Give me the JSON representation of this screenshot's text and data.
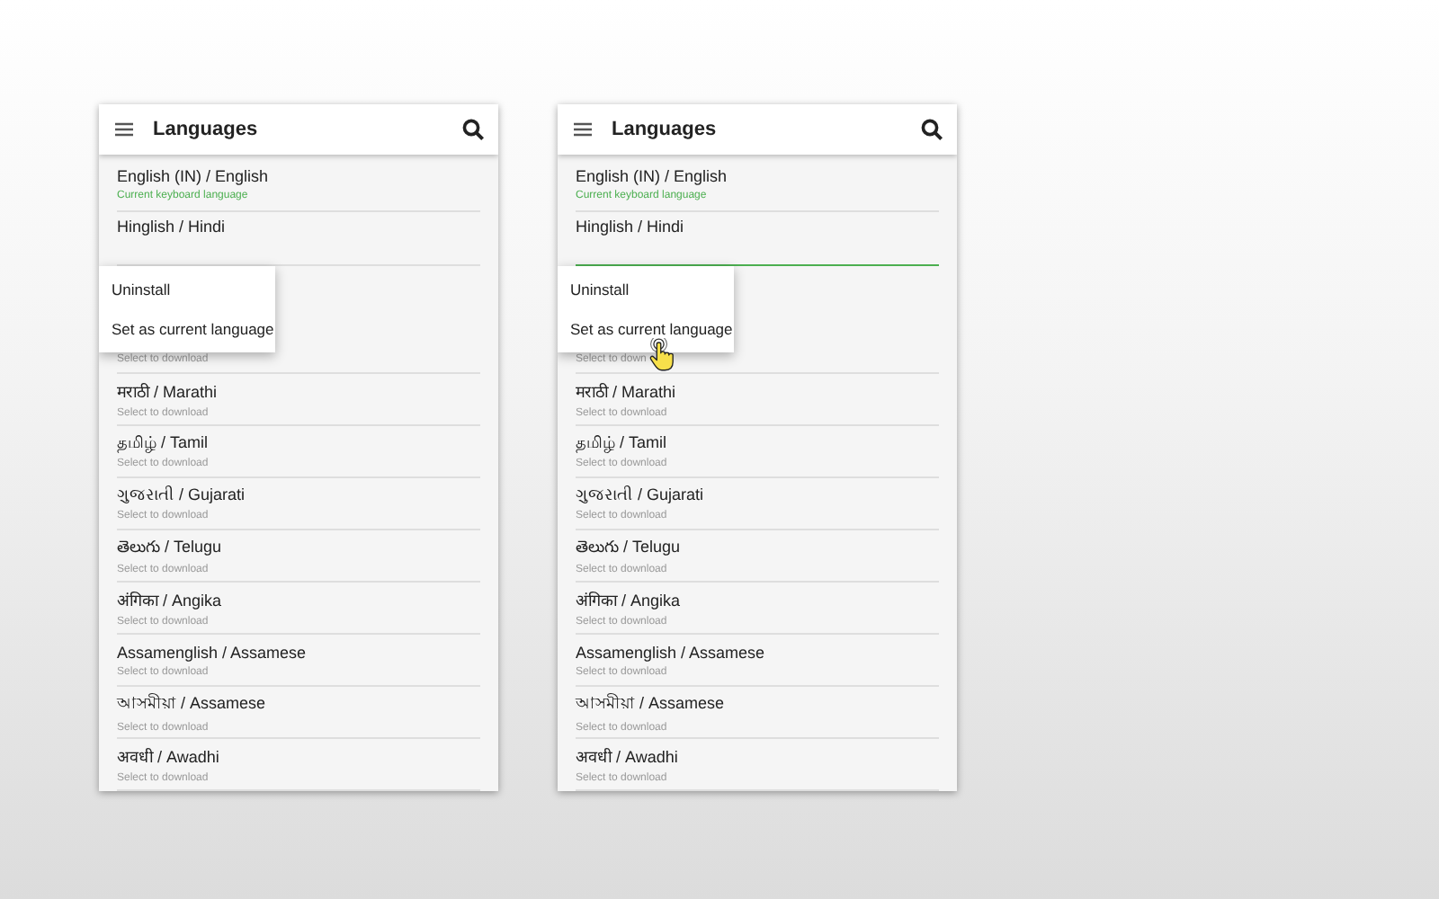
{
  "screens": [
    {
      "title": "Languages",
      "pointer": false,
      "languages": [
        {
          "kind": "full",
          "name": "English (IN) / English",
          "status": "Current keyboard language",
          "current": true
        },
        {
          "kind": "name-only",
          "name": "Hinglish / Hindi",
          "level": 0
        },
        {
          "kind": "partial",
          "status": "Select to download",
          "current": false
        },
        {
          "kind": "full",
          "name": "मराठी / Marathi",
          "status": "Select to download",
          "current": false
        },
        {
          "kind": "full",
          "name": "தமிழ் / Tamil",
          "status": "Select to download",
          "current": false
        },
        {
          "kind": "full",
          "name": "ગુજરાતી / Gujarati",
          "status": "Select to download",
          "current": false
        },
        {
          "kind": "full",
          "name": "తెలుగు / Telugu",
          "status": "Select to download",
          "current": false
        },
        {
          "kind": "full",
          "name": "अंगिका / Angika",
          "status": "Select to download",
          "current": false
        },
        {
          "kind": "full",
          "name": "Assamenglish / Assamese",
          "status": "Select to download",
          "current": false
        },
        {
          "kind": "full",
          "name": "আসমীয়া / Assamese",
          "status": "Select to download",
          "current": false
        },
        {
          "kind": "full",
          "name": "अवधी / Awadhi",
          "status": "Select to download",
          "current": false
        }
      ],
      "menu": [
        "Uninstall",
        "Set as current language"
      ]
    },
    {
      "title": "Languages",
      "pointer": true,
      "languages": [
        {
          "kind": "full",
          "name": "English (IN) / English",
          "status": "Current keyboard language",
          "current": true
        },
        {
          "kind": "name-only",
          "name": "Hinglish / Hindi",
          "level": 1
        },
        {
          "kind": "partial",
          "status": "Select to down",
          "current": false
        },
        {
          "kind": "full",
          "name": "मराठी / Marathi",
          "status": "Select to download",
          "current": false
        },
        {
          "kind": "full",
          "name": "தமிழ் / Tamil",
          "status": "Select to download",
          "current": false
        },
        {
          "kind": "full",
          "name": "ગુજરાતી / Gujarati",
          "status": "Select to download",
          "current": false
        },
        {
          "kind": "full",
          "name": "తెలుగు / Telugu",
          "status": "Select to download",
          "current": false
        },
        {
          "kind": "full",
          "name": "अंगिका / Angika",
          "status": "Select to download",
          "current": false
        },
        {
          "kind": "full",
          "name": "Assamenglish / Assamese",
          "status": "Select to download",
          "current": false
        },
        {
          "kind": "full",
          "name": "আসমীয়া / Assamese",
          "status": "Select to download",
          "current": false
        },
        {
          "kind": "full",
          "name": "अवधी / Awadhi",
          "status": "Select to download",
          "current": false
        }
      ],
      "menu": [
        "Uninstall",
        "Set as current language"
      ]
    }
  ]
}
